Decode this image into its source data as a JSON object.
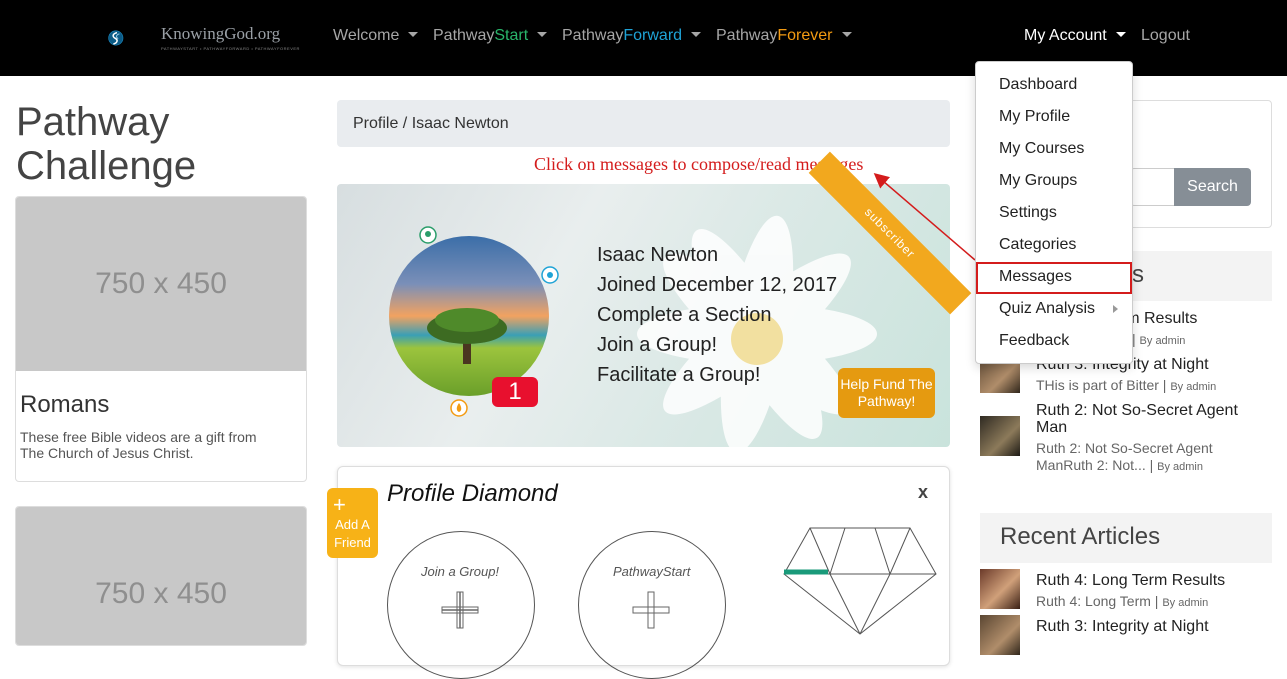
{
  "nav": {
    "logo_text": "KnowingGod.org",
    "logo_sub": "PATHWAYSTART • PATHWAYFORWARD • PATHWAYFOREVER",
    "items": [
      {
        "pre": "Welcome",
        "accent": ""
      },
      {
        "pre": "Pathway",
        "accent": "Start"
      },
      {
        "pre": "Pathway",
        "accent": "Forward"
      },
      {
        "pre": "Pathway",
        "accent": "Forever"
      }
    ],
    "my_account": "My Account",
    "logout": "Logout"
  },
  "account_menu": {
    "items": [
      "Dashboard",
      "My Profile",
      "My Courses",
      "My Groups",
      "Settings",
      "Categories",
      "Messages",
      "Quiz Analysis",
      "Feedback"
    ]
  },
  "left": {
    "title": "Pathway Challenge",
    "cards": [
      {
        "image": "750 x 450",
        "title": "Romans",
        "text": "These free Bible videos are a gift from The Church of Jesus Christ."
      },
      {
        "image": "750 x 450"
      }
    ]
  },
  "breadcrumb": {
    "root": "Profile",
    "sep": " / ",
    "current": "Isaac Newton"
  },
  "annotation": "Click on messages to compose/read messages",
  "profile": {
    "ribbon": "subscriber",
    "name": "Isaac Newton",
    "joined": "Joined December 12, 2017",
    "lines": [
      "Complete a Section",
      "Join a Group!",
      "Facilitate a Group!"
    ],
    "badge_count": "1",
    "fund_button": "Help Fund The Pathway!"
  },
  "diamond": {
    "title": "Profile Diamond",
    "close": "x",
    "add_friend": "Add A Friend",
    "add_plus": "+",
    "circles": [
      "Join a Group!",
      "PathwayStart"
    ]
  },
  "right": {
    "search_button": "Search",
    "recent_posts_partial": "s",
    "posts": [
      {
        "title": "Term Results",
        "excerpt": "erm",
        "by": "By admin"
      },
      {
        "title": "Ruth 3: Integrity at Night",
        "excerpt": "THis is part of Bitter",
        "by": "By admin"
      },
      {
        "title": "Ruth 2: Not So-Secret Agent Man",
        "excerpt": "Ruth 2: Not So-Secret Agent ManRuth 2: Not...",
        "by": "By admin"
      }
    ],
    "recent_articles_title": "Recent Articles",
    "articles": [
      {
        "title": "Ruth 4: Long Term Results",
        "excerpt": "Ruth 4: Long Term",
        "by": "By admin"
      },
      {
        "title": "Ruth 3: Integrity at Night"
      }
    ]
  },
  "colors": {
    "start": "#29b56b",
    "forward": "#1fa3d6",
    "forever": "#f39b12",
    "highlight": "#d41c1c"
  }
}
